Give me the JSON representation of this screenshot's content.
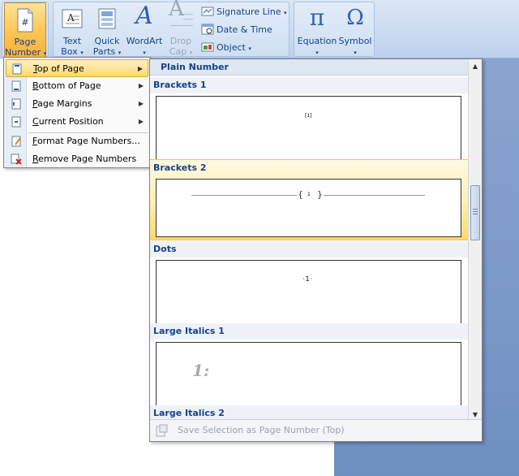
{
  "ribbon": {
    "page_number": {
      "line1": "Page",
      "line2": "Number"
    },
    "text_box": {
      "line1": "Text",
      "line2": "Box"
    },
    "quick_parts": {
      "line1": "Quick",
      "line2": "Parts"
    },
    "wordart": {
      "line1": "WordArt"
    },
    "drop_cap": {
      "line1": "Drop",
      "line2": "Cap"
    },
    "signature_line": "Signature Line",
    "date_time": "Date & Time",
    "object": "Object",
    "equation": "Equation",
    "symbol": "Symbol",
    "equation_glyph": "π",
    "symbol_glyph": "Ω",
    "wordart_glyph": "A",
    "dropcap_glyph": "A",
    "page_glyph": "#"
  },
  "menu": {
    "items": [
      {
        "accel": "T",
        "rest": "op of Page",
        "submenu": true
      },
      {
        "accel": "B",
        "rest": "ottom of Page",
        "submenu": true
      },
      {
        "accel": "P",
        "rest": "age Margins",
        "submenu": true
      },
      {
        "accel": "C",
        "rest": "urrent Position",
        "submenu": true
      },
      {
        "accel": "F",
        "rest": "ormat Page Numbers...",
        "submenu": false
      },
      {
        "accel": "R",
        "rest": "emove Page Numbers",
        "submenu": false
      }
    ]
  },
  "gallery": {
    "header": "Plain Number",
    "sections": [
      {
        "title": "Brackets 1",
        "sample": "[1]"
      },
      {
        "title": "Brackets 2",
        "sample_left": "{",
        "sample_num": "1",
        "sample_right": "}"
      },
      {
        "title": "Dots",
        "sample": "·1·"
      },
      {
        "title": "Large Italics 1",
        "sample": "1:"
      },
      {
        "title": "Large Italics 2"
      }
    ],
    "footer": "Save Selection as Page Number (Top)"
  },
  "colors": {
    "ribbon_text": "#15428b",
    "hover_gold": "#ffd86e",
    "accent_blue": "#3b6cb4"
  }
}
